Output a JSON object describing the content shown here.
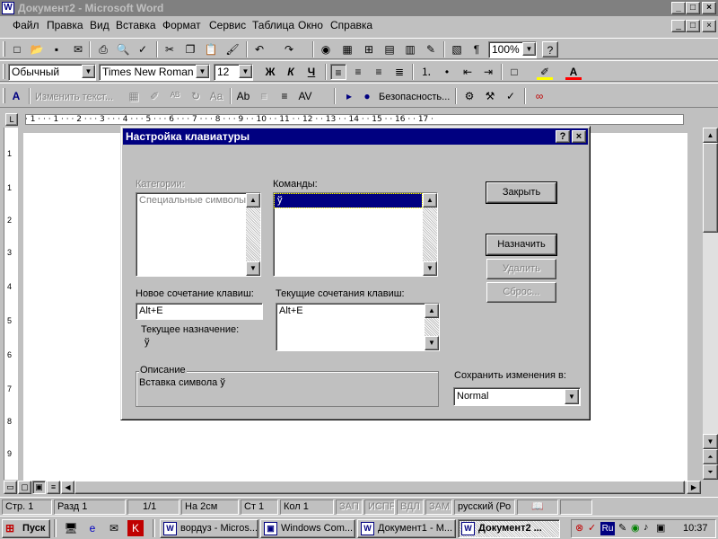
{
  "window": {
    "title": "Документ2 - Microsoft Word",
    "app_icon": "W",
    "minimize": "_",
    "maximize": "□",
    "close": "×"
  },
  "menu": [
    "Файл",
    "Правка",
    "Вид",
    "Вставка",
    "Формат",
    "Сервис",
    "Таблица",
    "Окно",
    "Справка"
  ],
  "standard_toolbar": {
    "zoom": "100%",
    "help_glyph": "?"
  },
  "format_toolbar": {
    "style": "Обычный",
    "font": "Times New Roman",
    "size": "12",
    "bold": "Ж",
    "italic": "К",
    "underline": "Ч"
  },
  "drawing_toolbar": {
    "change_text": "Изменить текст...",
    "security": "Безопасность..."
  },
  "ruler": {
    "marks": "· 1 · · · 1 · · · 2 · · · 3 · · · 4 · · · 5 · · · 6 · · · 7 · · · 8 · · · 9 · · 10 · · 11 · · 12 · · 13 · · 14 · · 15 · · 16 · · 17 ·"
  },
  "vertical_ruler": [
    "1",
    "1",
    "2",
    "3",
    "4",
    "5",
    "6",
    "7",
    "8",
    "9"
  ],
  "dialog": {
    "title": "Настройка клавиатуры",
    "help": "?",
    "close": "×",
    "categories_label": "Категории:",
    "categories_value": "Специальные символы",
    "commands_label": "Команды:",
    "commands_selected": "ў",
    "new_shortcut_label": "Новое сочетание клавиш:",
    "new_shortcut_value": "Alt+E",
    "current_shortcuts_label": "Текущие сочетания клавиш:",
    "current_shortcuts_value": "Alt+E",
    "current_assignment_label": "Текущее назначение:",
    "current_assignment_value": "ў",
    "description_label": "Описание",
    "description_value": "Вставка символа ў",
    "save_in_label": "Сохранить изменения в:",
    "save_in_value": "Normal",
    "btn_close": "Закрыть",
    "btn_assign": "Назначить",
    "btn_remove": "Удалить",
    "btn_reset": "Сброс..."
  },
  "statusbar": {
    "page": "Стр. 1",
    "section": "Разд 1",
    "pages": "1/1",
    "at": "На 2см",
    "line": "Ст 1",
    "col": "Кол 1",
    "rec": "ЗАП",
    "trk": "ИСПР",
    "ext": "ВДЛ",
    "ovr": "ЗАМ",
    "language": "русский (Ро"
  },
  "taskbar": {
    "start": "Пуск",
    "tasks": [
      {
        "label": "вордуз - Micros...",
        "icon": "W"
      },
      {
        "label": "Windows Com...",
        "icon": "▣"
      },
      {
        "label": "Документ1 - М...",
        "icon": "W"
      },
      {
        "label": "Документ2 ...",
        "icon": "W"
      }
    ],
    "clock": "10:37",
    "tray_lang": "Ru"
  }
}
